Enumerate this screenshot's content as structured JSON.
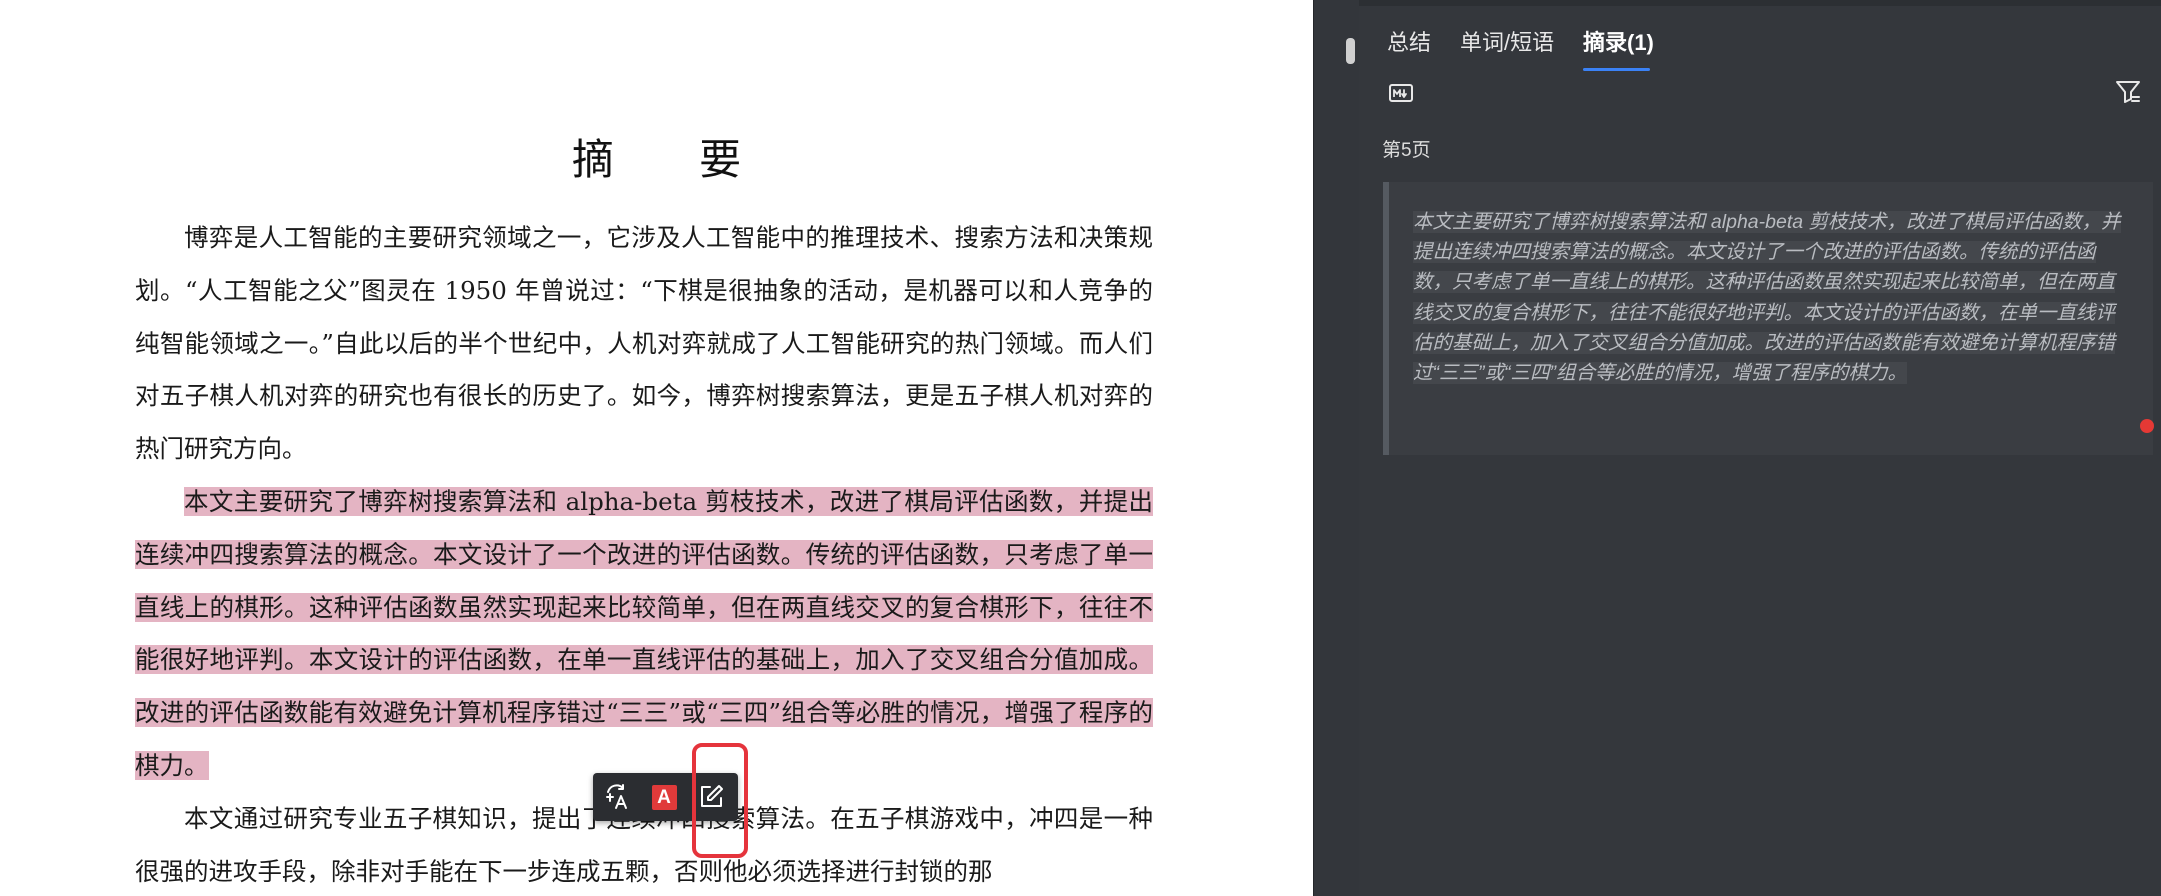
{
  "document": {
    "title": "摘 要",
    "paragraph1": "博弈是人工智能的主要研究领域之一，它涉及人工智能中的推理技术、搜索方法和决策规划。“人工智能之父”图灵在 1950 年曾说过：“下棋是很抽象的活动，是机器可以和人竞争的纯智能领域之一。”自此以后的半个世纪中，人机对弈就成了人工智能研究的热门领域。而人们对五子棋人机对弈的研究也有很长的历史了。如今，博弈树搜索算法，更是五子棋人机对弈的热门研究方向。",
    "paragraph2_highlighted": "本文主要研究了博弈树搜索算法和 alpha-beta 剪枝技术，改进了棋局评估函数，并提出连续冲四搜索算法的概念。本文设计了一个改进的评估函数。传统的评估函数，只考虑了单一直线上的棋形。这种评估函数虽然实现起来比较简单，但在两直线交叉的复合棋形下，往往不能很好地评判。本文设计的评估函数，在单一直线评估的基础上，加入了交叉组合分值加成。改进的评估函数能有效避免计算机程序错过“三三”或“三四”组合等必胜的情况，增强了程序的棋力。",
    "paragraph3": "本文通过研究专业五子棋知识，提出了连续冲四搜索算法。在五子棋游戏中，冲四是一种很强的进攻手段，除非对手能在下一步连成五颗，否则他必须选择进行封锁的那"
  },
  "popup_toolbar": {
    "translate_icon": "translate-icon",
    "highlight_label": "A",
    "note_icon": "edit-note-icon"
  },
  "panel": {
    "tabs": [
      "总结",
      "单词/短语",
      "摘录(1)"
    ],
    "active_tab": "摘录(1)",
    "page_label": "第5页",
    "excerpt_text": "本文主要研究了博弈树搜索算法和 alpha-beta 剪枝技术，改进了棋局评估函数，并提出连续冲四搜索算法的概念。本文设计了一个改进的评估函数。传统的评估函数，只考虑了单一直线上的棋形。这种评估函数虽然实现起来比较简单，但在两直线交叉的复合棋形下，往往不能很好地评判。本文设计的评估函数，在单一直线评估的基础上，加入了交叉组合分值加成。改进的评估函数能有效避免计算机程序错过“三三”或“三四”组合等必胜的情况，增强了程序的棋力。"
  },
  "colors": {
    "highlight": "#e4b4c3",
    "panel_bg": "#34373c",
    "tab_active_underline": "#3b82f6",
    "focus_box": "#e5343c",
    "marker_dot": "#e53935"
  }
}
